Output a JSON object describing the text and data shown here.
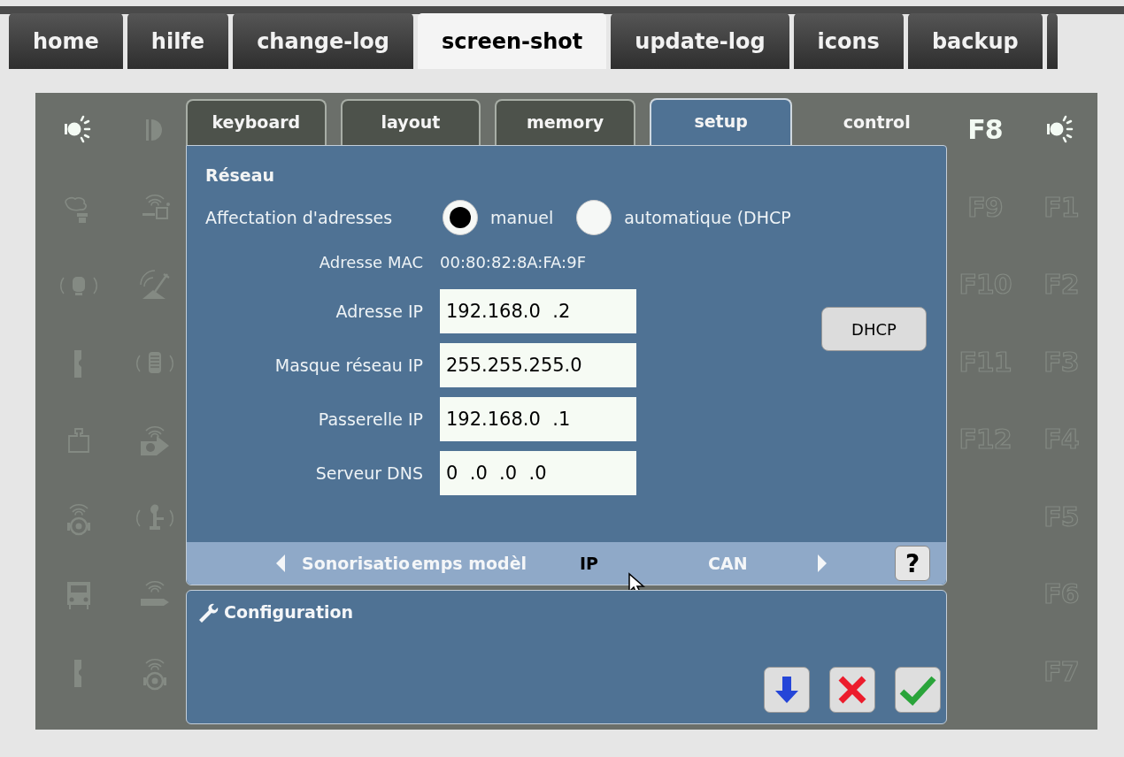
{
  "site_tabs": [
    {
      "label": "home",
      "selected": false
    },
    {
      "label": "hilfe",
      "selected": false
    },
    {
      "label": "change-log",
      "selected": false
    },
    {
      "label": "screen-shot",
      "selected": true
    },
    {
      "label": "update-log",
      "selected": false
    },
    {
      "label": "icons",
      "selected": false
    },
    {
      "label": "backup",
      "selected": false
    }
  ],
  "function_icons": {
    "column_1": [
      {
        "kind": "light",
        "on": true
      },
      {
        "kind": "smoke",
        "on": false
      },
      {
        "kind": "sound-wagon",
        "on": false
      },
      {
        "kind": "coupler",
        "on": false
      },
      {
        "kind": "weight",
        "on": false
      },
      {
        "kind": "sound-wheel",
        "on": false
      },
      {
        "kind": "front",
        "on": false
      },
      {
        "kind": "coupler",
        "on": false
      }
    ],
    "column_2": [
      {
        "kind": "headlight",
        "on": false
      },
      {
        "kind": "sound-buffer",
        "on": false
      },
      {
        "kind": "shovel",
        "on": false
      },
      {
        "kind": "sound-grille",
        "on": false
      },
      {
        "kind": "fan",
        "on": false
      },
      {
        "kind": "sound-pump",
        "on": false
      },
      {
        "kind": "sound-arrow",
        "on": false
      },
      {
        "kind": "sound-wheel",
        "on": false
      }
    ]
  },
  "function_keys": {
    "column_1": [
      {
        "kind": "key",
        "label": "F8",
        "on": true
      },
      {
        "kind": "key",
        "label": "F9",
        "on": false
      },
      {
        "kind": "key",
        "label": "F10",
        "on": false
      },
      {
        "kind": "key",
        "label": "F11",
        "on": false
      },
      {
        "kind": "key",
        "label": "F12",
        "on": false
      }
    ],
    "column_2": [
      {
        "kind": "light",
        "on": true
      },
      {
        "kind": "key",
        "label": "F1",
        "on": false
      },
      {
        "kind": "key",
        "label": "F2",
        "on": false
      },
      {
        "kind": "key",
        "label": "F3",
        "on": false
      },
      {
        "kind": "key",
        "label": "F4",
        "on": false
      },
      {
        "kind": "key",
        "label": "F5",
        "on": false
      },
      {
        "kind": "key",
        "label": "F6",
        "on": false
      },
      {
        "kind": "key",
        "label": "F7",
        "on": false
      }
    ]
  },
  "device_tabs": [
    {
      "label": "keyboard",
      "selected": false
    },
    {
      "label": "layout",
      "selected": false
    },
    {
      "label": "memory",
      "selected": false
    },
    {
      "label": "setup",
      "selected": true
    },
    {
      "label": "control",
      "selected": false
    }
  ],
  "section_title": "Réseau",
  "address_mode": {
    "label": "Affectation d'adresses",
    "options": [
      {
        "label": "manuel",
        "selected": true
      },
      {
        "label": "automatique (DHCP",
        "selected": false
      }
    ]
  },
  "mac": {
    "label": "Adresse MAC",
    "value": "00:80:82:8A:FA:9F"
  },
  "fields": [
    {
      "label": "Adresse IP",
      "value": "192.168.0  .2"
    },
    {
      "label": "Masque réseau IP",
      "value": "255.255.255.0"
    },
    {
      "label": "Passerelle IP",
      "value": "192.168.0  .1"
    },
    {
      "label": "Serveur DNS",
      "value": "0  .0  .0  .0"
    }
  ],
  "dhcp_button": "DHCP",
  "submenu": {
    "items": [
      {
        "label": "Sonorisatio",
        "selected": false
      },
      {
        "label": "emps modèl",
        "selected": false
      },
      {
        "label": "IP",
        "selected": true
      },
      {
        "label": "CAN",
        "selected": false
      }
    ],
    "help": "?"
  },
  "config": {
    "title": "Configuration"
  }
}
